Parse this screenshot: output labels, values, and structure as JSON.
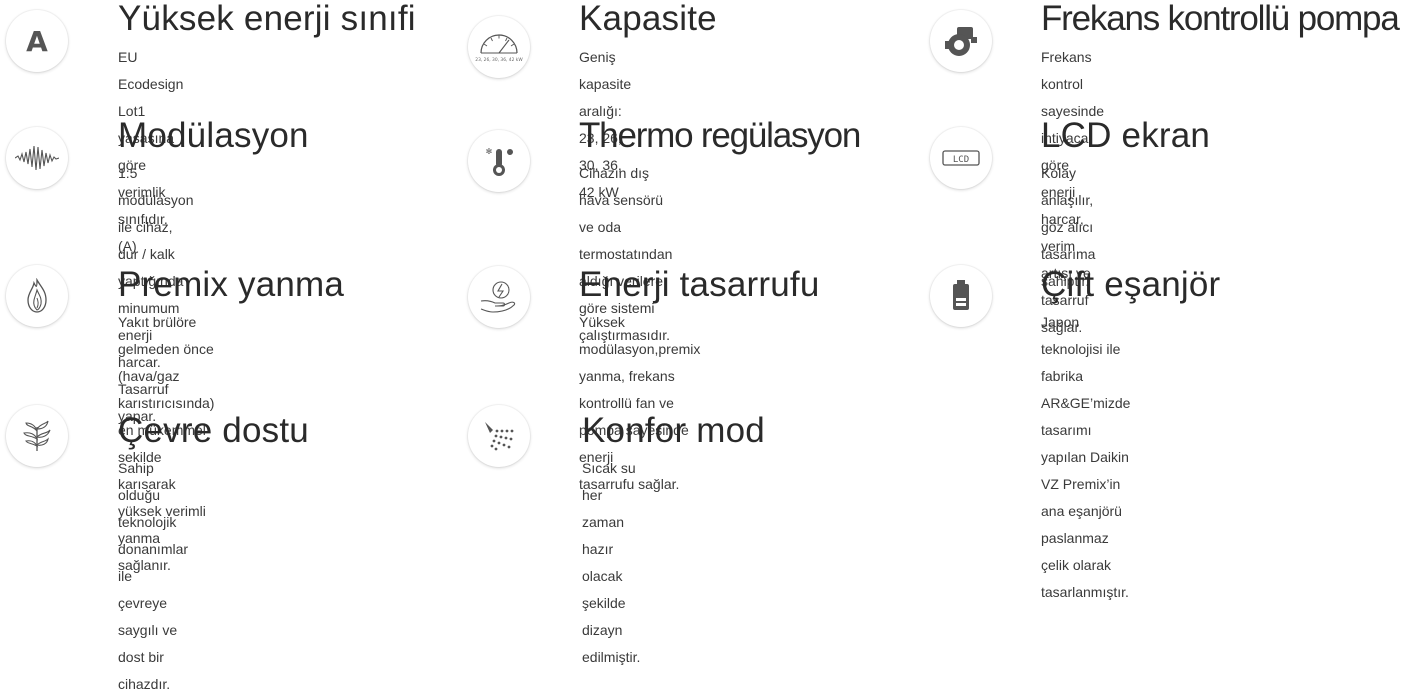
{
  "features": [
    {
      "id": "efficiency",
      "icon": "letter-a-icon",
      "title": "Yüksek enerji sınıfi",
      "lines": [
        "EU Ecodesign Lot1 yasasına göre verimlik",
        "sınıfıdır. (A)"
      ],
      "icon_text": "A"
    },
    {
      "id": "capacity",
      "icon": "gauge-icon",
      "title": "Kapasite",
      "lines": [
        "Geniş kapasite aralığı: 23, 26, 30, 36, 42 kW"
      ],
      "icon_text": "23, 26, 30, 36, 42 kW"
    },
    {
      "id": "pump",
      "icon": "pump-icon",
      "title": "Frekans kontrollü pompa",
      "lines": [
        "Frekans kontrol sayesinde ihtiyaca göre enerji",
        "harcar, verim artışı ve tasarruf sağlar."
      ]
    },
    {
      "id": "modulation",
      "icon": "waveform-icon",
      "title": "Modülasyon",
      "lines": [
        "1:5 modülasyon ile cihaz, dur / kalk",
        "yaptığında minumum enerji harcar. Tasarruf",
        "yapar."
      ]
    },
    {
      "id": "thermo",
      "icon": "thermometer-icon",
      "title": "Thermo regülasyon",
      "lines": [
        "Cihazın dış hava sensörü ve oda",
        "termostatından aldığı verilere göre sistemi",
        "çalıştırmasıdır."
      ]
    },
    {
      "id": "lcd",
      "icon": "lcd-display-icon",
      "title": "LCD ekran",
      "lines": [
        "Kolay anlaşılır, göz alıcı tasarıma sahiptir."
      ],
      "icon_text": "LCD"
    },
    {
      "id": "premix",
      "icon": "flame-icon",
      "title": "Premix yanma",
      "lines": [
        "Yakıt brülöre gelmeden önce (hava/gaz",
        "karıstırıcısında) en mükemmel sekilde",
        "karısarak yüksek verimli yanma sağlanır."
      ]
    },
    {
      "id": "saving",
      "icon": "hand-energy-icon",
      "title": "Enerji  tasarrufu",
      "lines": [
        "Yüksek modülasyon,premix yanma, frekans",
        "kontrollü fan ve pompa sayesinde enerji",
        "tasarrufu sağlar."
      ]
    },
    {
      "id": "exchanger",
      "icon": "heat-exchanger-icon",
      "title": "Çift eşanjör",
      "lines": [
        "Japon teknolojisi ile fabrika AR&GE’mizde",
        "tasarımı yapılan Daikin VZ Premix’in",
        "ana eşanjörü paslanmaz çelik olarak",
        "tasarlanmıştır."
      ]
    },
    {
      "id": "eco",
      "icon": "plant-icon",
      "title": "Çevre dostu",
      "lines": [
        "Sahip olduğu teknolojik donanımlar ile",
        "çevreye saygılı ve dost bir cihazdır."
      ]
    },
    {
      "id": "comfort",
      "icon": "shower-icon",
      "title": "Konfor mod",
      "lines": [
        "Sıcak su her zaman hazır olacak şekilde",
        "dizayn edilmiştir."
      ]
    }
  ]
}
